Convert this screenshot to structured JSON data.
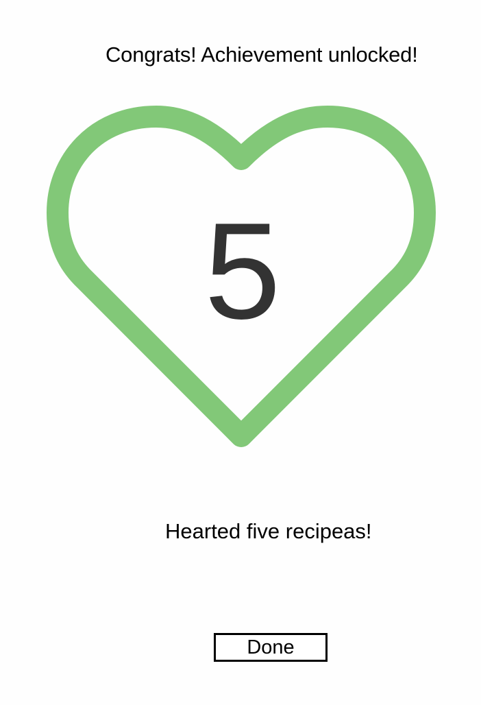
{
  "header": {
    "title": "Congrats! Achievement unlocked!"
  },
  "achievement": {
    "icon": "heart-icon",
    "accent_color": "#82c878",
    "count": "5",
    "message": "Hearted five recipeas!"
  },
  "actions": {
    "done_label": "Done"
  }
}
